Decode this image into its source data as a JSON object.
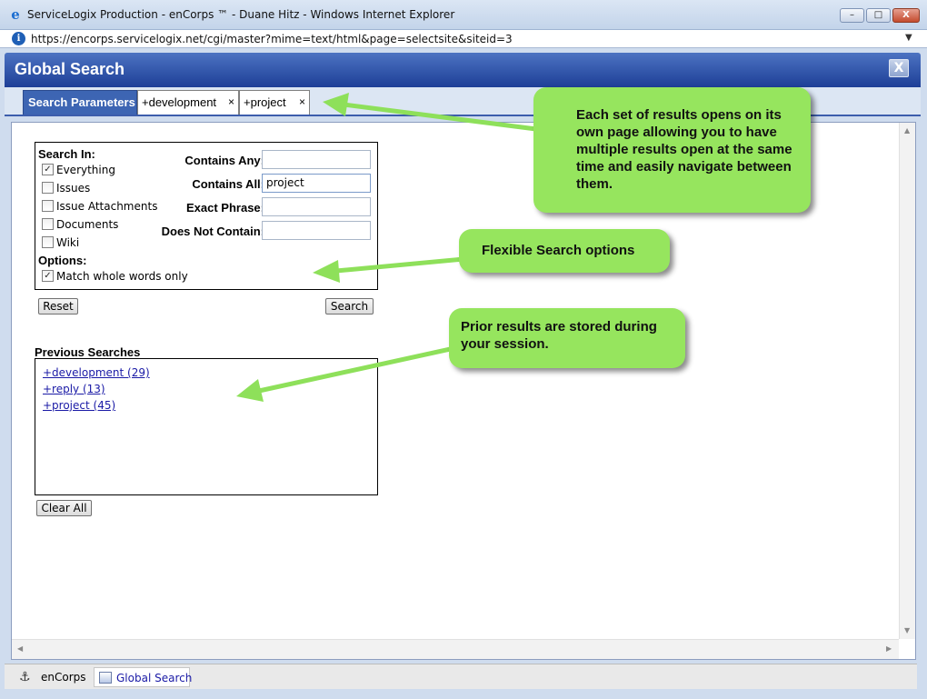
{
  "window": {
    "title": "ServiceLogix Production - enCorps ™ - Duane Hitz - Windows Internet Explorer",
    "url": "https://encorps.servicelogix.net/cgi/master?mime=text/html&page=selectsite&siteid=3",
    "min_glyph": "–",
    "max_glyph": "□",
    "close_glyph": "X"
  },
  "app": {
    "title": "Global Search",
    "close_glyph": "X"
  },
  "tabs": [
    {
      "label": "Search Parameters",
      "closable": false
    },
    {
      "label": "+development",
      "closable": true
    },
    {
      "label": "+project",
      "closable": true
    }
  ],
  "tab_close_glyph": "×",
  "search": {
    "search_in_label": "Search In:",
    "categories": [
      {
        "label": "Everything",
        "checked": true
      },
      {
        "label": "Issues",
        "checked": false
      },
      {
        "label": "Issue Attachments",
        "checked": false
      },
      {
        "label": "Documents",
        "checked": false
      },
      {
        "label": "Wiki",
        "checked": false
      }
    ],
    "options_label": "Options:",
    "options": [
      {
        "label": "Match whole words only",
        "checked": true
      }
    ],
    "fields": [
      {
        "label": "Contains Any:",
        "value": ""
      },
      {
        "label": "Contains All:",
        "value": "project"
      },
      {
        "label": "Exact Phrase:",
        "value": ""
      },
      {
        "label": "Does Not Contain:",
        "value": ""
      }
    ],
    "reset_label": "Reset",
    "search_label": "Search"
  },
  "previous": {
    "title": "Previous Searches",
    "items": [
      "+development (29)",
      "+reply (13)",
      "+project (45)"
    ],
    "clear_label": "Clear All"
  },
  "callouts": [
    "Each set of results opens on its own page allowing you to have multiple results open at the same time and easily navigate between them.",
    "Flexible Search options",
    "Prior results are stored during your session."
  ],
  "statusbar": {
    "items": [
      "enCorps",
      "Global Search"
    ]
  },
  "colors": {
    "header": "#2b4fa5",
    "callout": "#96e55e",
    "arrow": "#8ee05a",
    "link": "#1a1aa6"
  }
}
